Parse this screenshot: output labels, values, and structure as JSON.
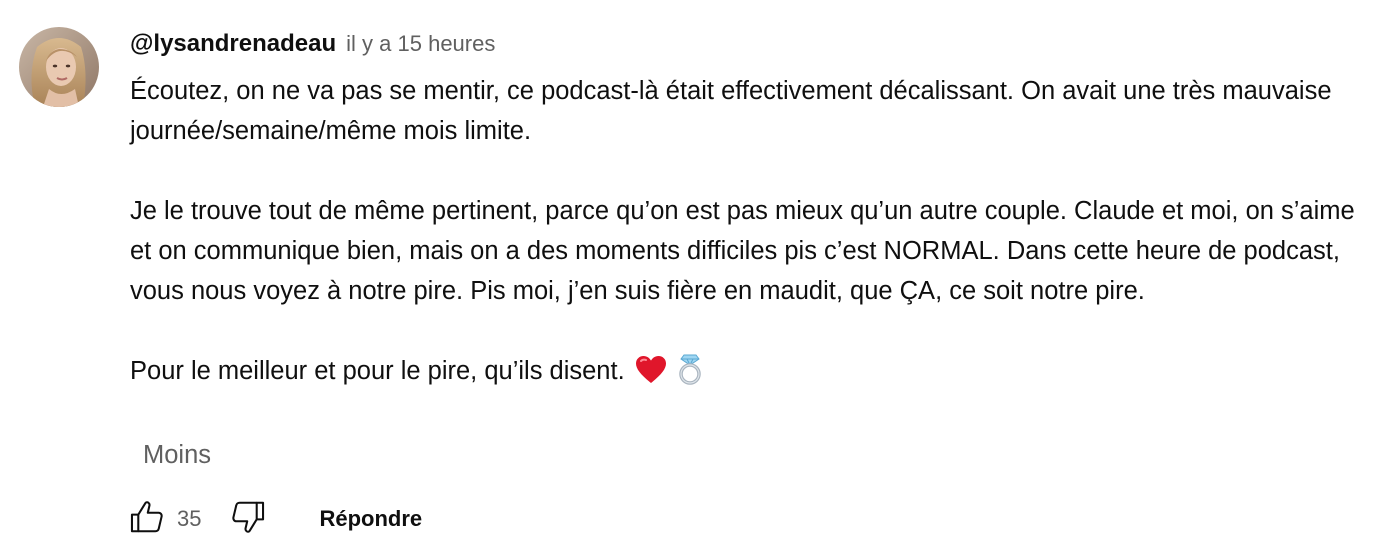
{
  "comment": {
    "author": "@lysandrenadeau",
    "timestamp": "il y a 15 heures",
    "paragraphs": [
      "Écoutez, on ne va pas se mentir, ce podcast-là était effectivement décalissant. On avait une très mauvaise journée/semaine/même mois limite.",
      "Je le trouve tout de même pertinent, parce qu’on est pas mieux qu’un autre couple. Claude et moi, on s’aime et on communique bien, mais on a des moments difficiles pis c’est NORMAL. Dans cette heure de podcast, vous nous voyez à notre pire. Pis moi, j’en suis fière en maudit, que ÇA, ce soit notre pire.",
      "Pour le meilleur et pour le pire, qu’ils disent."
    ],
    "emojis": [
      "red-heart",
      "ring"
    ],
    "show_less_label": "Moins",
    "like_count": "35",
    "reply_label": "Répondre"
  },
  "colors": {
    "text_primary": "#0f0f0f",
    "text_secondary": "#606060",
    "heart": "#e0162b"
  }
}
